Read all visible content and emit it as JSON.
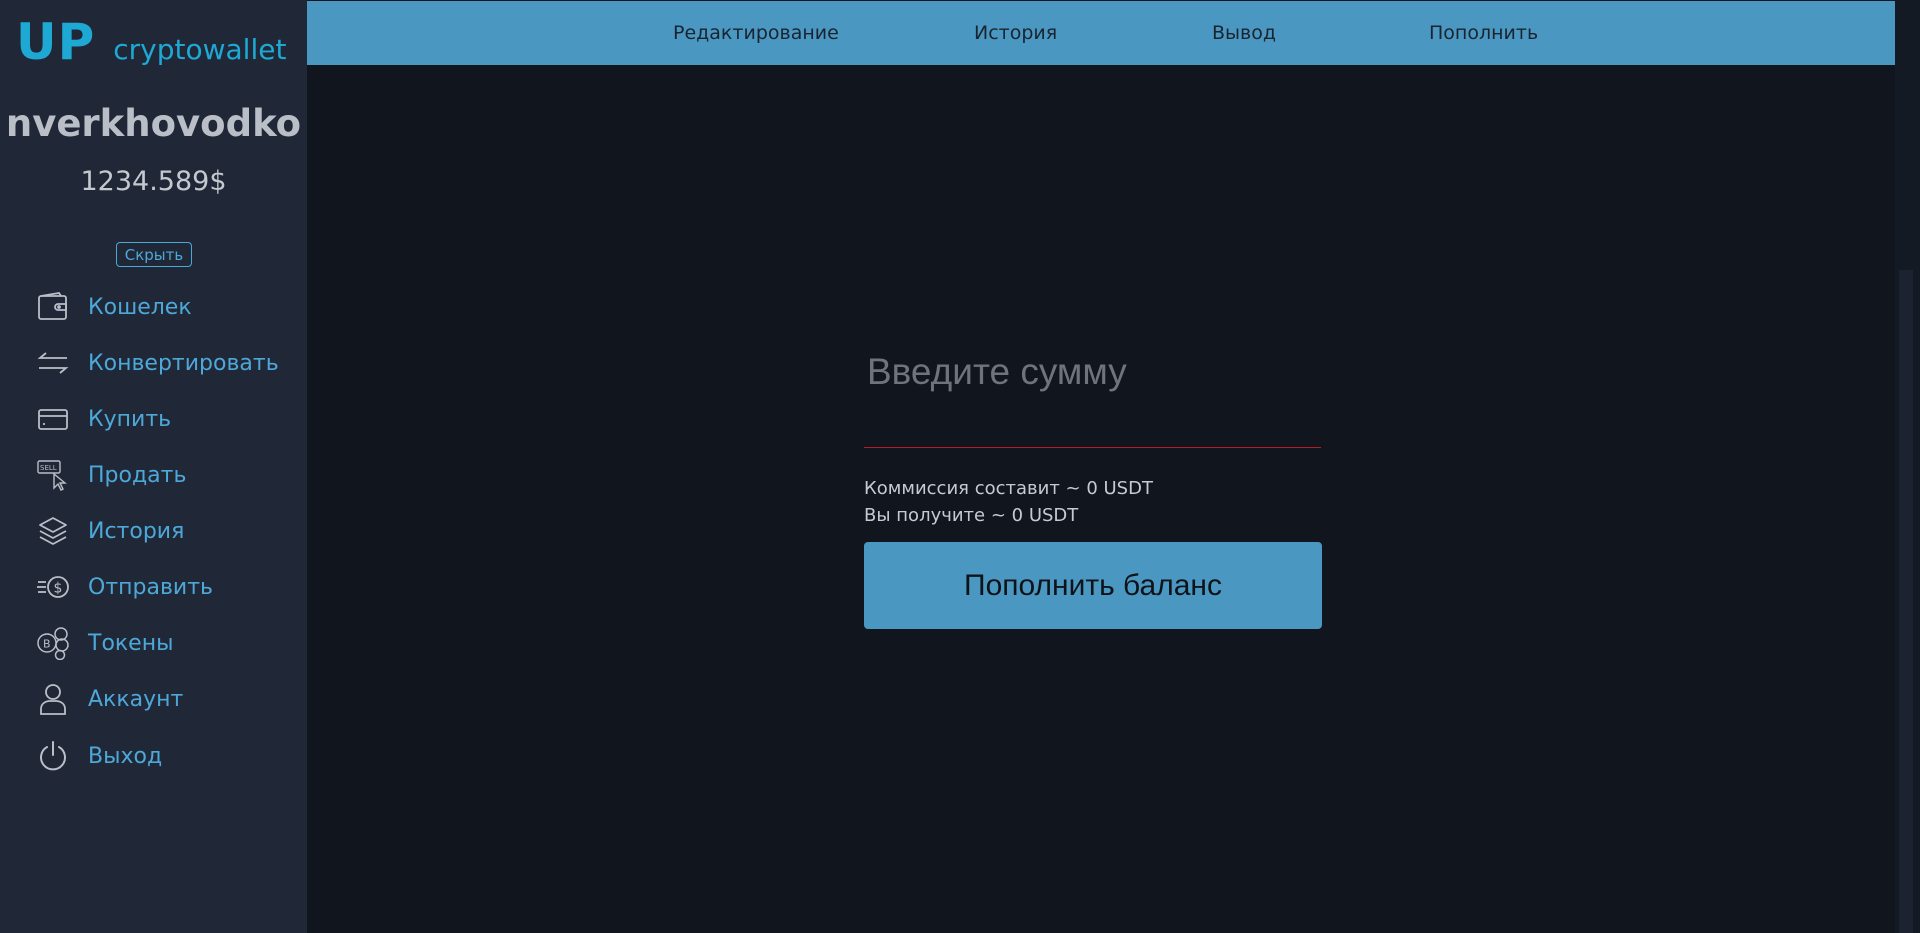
{
  "brand": {
    "logo_main": "UP",
    "logo_sub": "cryptowallet"
  },
  "user": {
    "username": "nverkhovodko",
    "balance": "1234.589$",
    "hide_label": "Скрыть"
  },
  "sidebar": {
    "items": [
      {
        "label": "Кошелек",
        "icon": "wallet-icon"
      },
      {
        "label": "Конвертировать",
        "icon": "convert-arrows-icon"
      },
      {
        "label": "Купить",
        "icon": "card-icon"
      },
      {
        "label": "Продать",
        "icon": "sell-icon"
      },
      {
        "label": "История",
        "icon": "layers-icon"
      },
      {
        "label": "Отправить",
        "icon": "send-dollar-icon"
      },
      {
        "label": "Токены",
        "icon": "tokens-icon"
      },
      {
        "label": "Аккаунт",
        "icon": "user-icon"
      },
      {
        "label": "Выход",
        "icon": "power-icon"
      }
    ]
  },
  "topnav": {
    "tabs": [
      "Редактирование",
      "История",
      "Вывод",
      "Пополнить"
    ]
  },
  "form": {
    "amount_placeholder": "Введите сумму",
    "amount_value": "",
    "commission_text": "Коммиссия составит ~ 0 USDT",
    "receive_text": "Вы получите ~ 0 USDT",
    "submit_label": "Пополнить баланс"
  },
  "colors": {
    "accent": "#4a98c2",
    "link": "#4da8d8",
    "logo": "#1ea8d4",
    "sidebar_bg": "#202838",
    "main_bg": "#11151d",
    "input_underline": "#b21f27"
  }
}
